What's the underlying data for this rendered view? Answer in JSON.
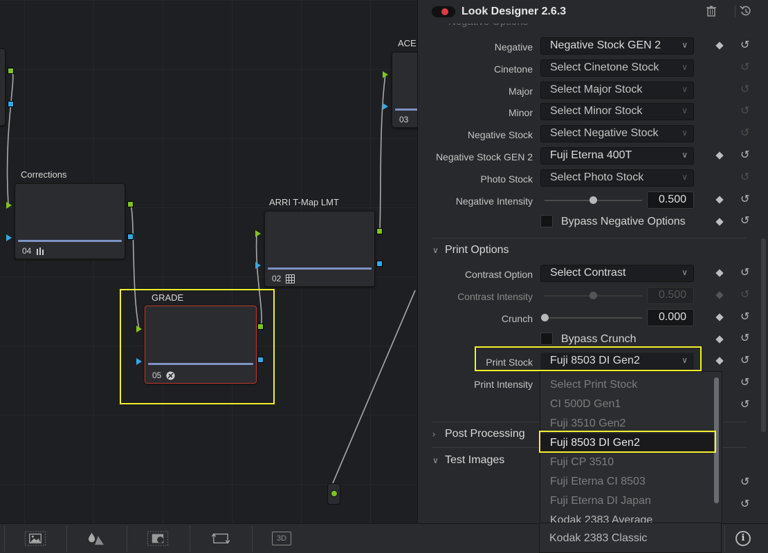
{
  "graph": {
    "nodes": [
      {
        "id": "corrections",
        "title": "Corrections",
        "number": "04",
        "icon": "bars-icon"
      },
      {
        "id": "arri",
        "title": "ARRI T-Map LMT",
        "number": "02",
        "icon": "grid-icon"
      },
      {
        "id": "grade",
        "title": "GRADE",
        "number": "05",
        "icon": "effect-icon"
      },
      {
        "id": "aces",
        "title": "ACE",
        "number": "03"
      }
    ]
  },
  "panel": {
    "title": "Look Designer 2.6.3",
    "enabled_color": "#e23b3b",
    "faded_section": "Negative Options",
    "rows": {
      "negative": {
        "label": "Negative",
        "value": "Negative Stock GEN 2"
      },
      "cinetone": {
        "label": "Cinetone",
        "value": "Select Cinetone Stock"
      },
      "major": {
        "label": "Major",
        "value": "Select Major Stock"
      },
      "minor": {
        "label": "Minor",
        "value": "Select Minor Stock"
      },
      "negative_stock": {
        "label": "Negative Stock",
        "value": "Select Negative Stock"
      },
      "negative_stock_gen2": {
        "label": "Negative Stock GEN 2",
        "value": "Fuji Eterna 400T"
      },
      "photo_stock": {
        "label": "Photo Stock",
        "value": "Select Photo Stock"
      },
      "negative_intensity": {
        "label": "Negative Intensity",
        "value": "0.500",
        "level": 0.5
      },
      "bypass_negative": {
        "label": "Bypass Negative Options"
      },
      "contrast_option": {
        "label": "Contrast Option",
        "value": "Select Contrast"
      },
      "contrast_intensity": {
        "label": "Contrast Intensity",
        "value": "0.500",
        "level": 0.5
      },
      "crunch": {
        "label": "Crunch",
        "value": "0.000",
        "level": 0.0
      },
      "bypass_crunch": {
        "label": "Bypass Crunch"
      },
      "print_stock": {
        "label": "Print Stock",
        "value": "Fuji 8503 DI Gen2"
      },
      "print_intensity": {
        "label": "Print Intensity"
      }
    },
    "sections": {
      "print_options": "Print Options",
      "post_processing": "Post Processing",
      "test_images": "Test Images"
    },
    "dropdown": {
      "options": [
        "Select Print Stock",
        "CI 500D Gen1",
        "Fuji 3510 Gen2",
        "Fuji 8503 DI Gen2",
        "Fuji CP 3510",
        "Fuji Eterna CI 8503",
        "Fuji Eterna DI Japan",
        "Kodak 2383 Average",
        "Kodak 2383 Classic"
      ],
      "selected": "Fuji 8503 DI Gen2"
    }
  },
  "toolbar": {
    "items": [
      "image-icon",
      "color-drops-icon",
      "media-icon",
      "transform-icon",
      "3d-icon"
    ],
    "label_3d": "3D",
    "info": "i"
  },
  "colors": {
    "highlight": "#f4f02c",
    "port_green": "#7fc322",
    "port_blue": "#35a7e6",
    "node_bar": "#7e93c4"
  }
}
